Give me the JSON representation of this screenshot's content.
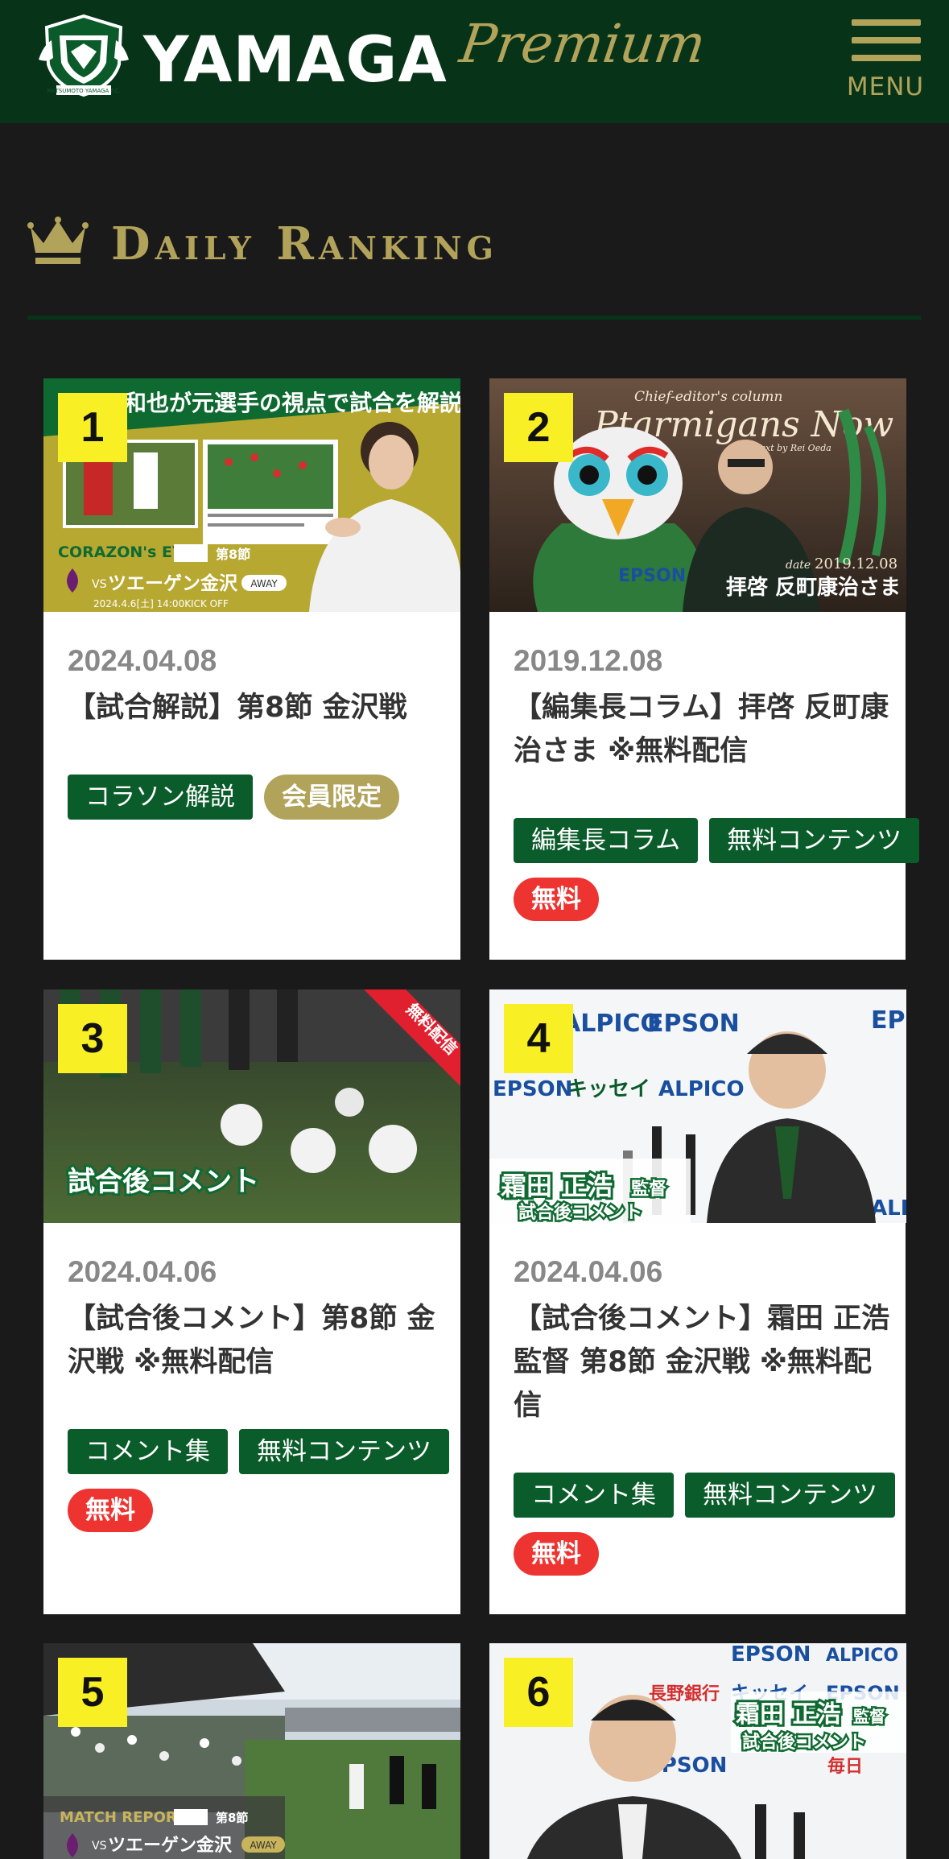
{
  "header": {
    "brand": "YAMAGA",
    "brand_suffix": "Premium",
    "menu_label": "MENU",
    "crest_text": "MATSUMOTO YAMAGA F.C."
  },
  "ranking": {
    "title": "Daily Ranking"
  },
  "colors": {
    "header_bg": "#073418",
    "accent_gold": "#b2a35b",
    "tag_green": "#0a5c2a",
    "free_red": "#ee3431",
    "badge_yellow": "#f8ef24",
    "page_bg": "#1a1a1a"
  },
  "cards": [
    {
      "rank": "1",
      "date": "2024.04.08",
      "title": "【試合解説】第8節 金沢戦",
      "tags": [
        "コラソン解説",
        "会員限定"
      ],
      "thumb": {
        "banner": "和也が元選手の視点で試合を解説!",
        "series": "CORAZON's EYE",
        "round": "第8節",
        "opponent": "ツエーゲン金沢",
        "vs": "VS",
        "away": "AWAY",
        "datetime": "2024.4.6[土] 14:00KICK OFF"
      }
    },
    {
      "rank": "2",
      "date": "2019.12.08",
      "title": "【編集長コラム】拝啓 反町康治さま ※無料配信",
      "tags": [
        "編集長コラム",
        "無料コンテンツ"
      ],
      "free": "無料",
      "thumb": {
        "subhead": "Chief-editor's column",
        "headline": "Ptarmigans Now",
        "byline": "Text by Rei Oeda",
        "date_label": "date",
        "date_value": "2019.12.08",
        "caption": "拝啓 反町康治さま",
        "shirt": "EPSON"
      }
    },
    {
      "rank": "3",
      "date": "2024.04.06",
      "title": "【試合後コメント】第8節 金沢戦 ※無料配信",
      "tags": [
        "コメント集",
        "無料コンテンツ"
      ],
      "free": "無料",
      "thumb": {
        "ribbon": "無料配信",
        "caption": "試合後コメント"
      }
    },
    {
      "rank": "4",
      "date": "2024.04.06",
      "title": "【試合後コメント】霜田 正浩監督 第8節 金沢戦 ※無料配信",
      "tags": [
        "コメント集",
        "無料コンテンツ"
      ],
      "free": "無料",
      "thumb": {
        "name": "霜田 正浩",
        "role": "監督",
        "caption": "試合後コメント",
        "sponsors": [
          "ALPICO",
          "EPSON",
          "キッセイ",
          "ALPICO",
          "EPSON",
          "EPS",
          "ALP"
        ]
      }
    },
    {
      "rank": "5",
      "thumb": {
        "series": "MATCH REPORT",
        "round": "第8節",
        "vs": "VS",
        "opponent": "ツエーゲン金沢",
        "away": "AWAY"
      }
    },
    {
      "rank": "6",
      "thumb": {
        "name": "霜田 正浩",
        "role": "監督",
        "caption": "試合後コメント",
        "sponsors": [
          "EPSON",
          "ALPICO",
          "長野銀行",
          "キッセイ",
          "EPSON",
          "EPSON",
          "毎日"
        ]
      }
    }
  ]
}
